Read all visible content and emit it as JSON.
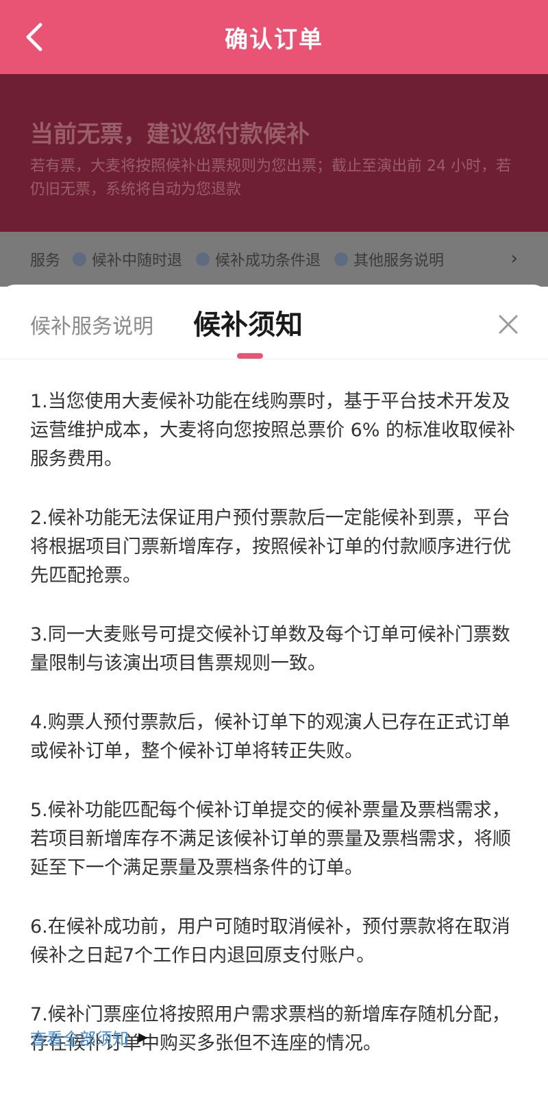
{
  "header": {
    "title": "确认订单"
  },
  "banner": {
    "title": "当前无票，建议您付款候补",
    "description": "若有票，大麦将按照候补出票规则为您出票；截止至演出前 24 小时，若仍旧无票，系统将自动为您退款"
  },
  "services": {
    "label": "服务",
    "items": [
      "候补中随时退",
      "候补成功条件退",
      "其他服务说明"
    ]
  },
  "sheet": {
    "tabs": [
      "候补服务说明",
      "候补须知"
    ],
    "notices": [
      "1.当您使用大麦候补功能在线购票时，基于平台技术开发及运营维护成本，大麦将向您按照总票价 6% 的标准收取候补服务费用。",
      "2.候补功能无法保证用户预付票款后一定能候补到票，平台将根据项目门票新增库存，按照候补订单的付款顺序进行优先匹配抢票。",
      "3.同一大麦账号可提交候补订单数及每个订单可候补门票数量限制与该演出项目售票规则一致。",
      "4.购票人预付票款后，候补订单下的观演人已存在正式订单或候补订单，整个候补订单将转正失败。",
      "5.候补功能匹配每个候补订单提交的候补票量及票档需求，若项目新增库存不满足该候补订单的票量及票档需求，将顺延至下一个满足票量及票档条件的订单。",
      "6.在候补成功前，用户可随时取消候补，预付票款将在取消候补之日起7个工作日内退回原支付账户。",
      "7.候补门票座位将按照用户需求票档的新增库存随机分配，存在候补订单中购买多张但不连座的情况。"
    ],
    "more_link": "查看全部须知"
  },
  "colors": {
    "accent": "#ea5474",
    "banner_bg": "#6e1f33",
    "link": "#4b8fd0"
  }
}
